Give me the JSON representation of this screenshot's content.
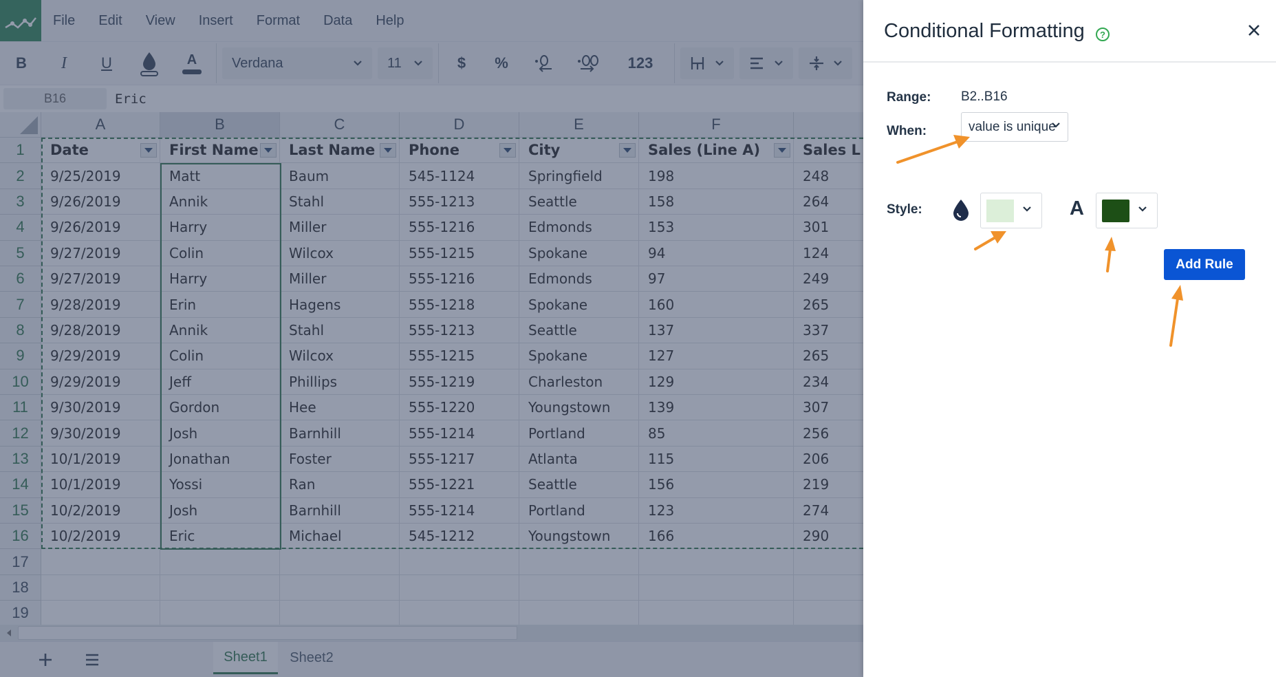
{
  "menubar": {
    "items": [
      "File",
      "Edit",
      "View",
      "Insert",
      "Format",
      "Data",
      "Help"
    ]
  },
  "toolbar": {
    "bold": "B",
    "italic": "I",
    "underline": "U",
    "font_color": "A",
    "font_family": "Verdana",
    "font_size": "11",
    "currency": "$",
    "percent": "%",
    "number_format": "123"
  },
  "formula_bar": {
    "cell_ref": "B16",
    "value": "Eric"
  },
  "grid": {
    "columns": [
      "A",
      "B",
      "C",
      "D",
      "E",
      "F"
    ],
    "selected_column": "B",
    "row_numbers": [
      "1",
      "2",
      "3",
      "4",
      "5",
      "6",
      "7",
      "8",
      "9",
      "10",
      "11",
      "12",
      "13",
      "14",
      "15",
      "16",
      "17",
      "18",
      "19"
    ],
    "header_row": [
      "Date",
      "First Name",
      "Last Name",
      "Phone",
      "City",
      "Sales (Line A)",
      "Sales L"
    ],
    "rows": [
      [
        "9/25/2019",
        "Matt",
        "Baum",
        "545-1124",
        "Springfield",
        "198",
        "248"
      ],
      [
        "9/26/2019",
        "Annik",
        "Stahl",
        "555-1213",
        "Seattle",
        "158",
        "264"
      ],
      [
        "9/26/2019",
        "Harry",
        "Miller",
        "555-1216",
        "Edmonds",
        "153",
        "301"
      ],
      [
        "9/27/2019",
        "Colin",
        "Wilcox",
        "555-1215",
        "Spokane",
        "94",
        "124"
      ],
      [
        "9/27/2019",
        "Harry",
        "Miller",
        "555-1216",
        "Edmonds",
        "97",
        "249"
      ],
      [
        "9/28/2019",
        "Erin",
        "Hagens",
        "555-1218",
        "Spokane",
        "160",
        "265"
      ],
      [
        "9/28/2019",
        "Annik",
        "Stahl",
        "555-1213",
        "Seattle",
        "137",
        "337"
      ],
      [
        "9/29/2019",
        "Colin",
        "Wilcox",
        "555-1215",
        "Spokane",
        "127",
        "265"
      ],
      [
        "9/29/2019",
        "Jeff",
        "Phillips",
        "555-1219",
        "Charleston",
        "129",
        "234"
      ],
      [
        "9/30/2019",
        "Gordon",
        "Hee",
        "555-1220",
        "Youngstown",
        "139",
        "307"
      ],
      [
        "9/30/2019",
        "Josh",
        "Barnhill",
        "555-1214",
        "Portland",
        "85",
        "256"
      ],
      [
        "10/1/2019",
        "Jonathan",
        "Foster",
        "555-1217",
        "Atlanta",
        "115",
        "206"
      ],
      [
        "10/1/2019",
        "Yossi",
        "Ran",
        "555-1221",
        "Seattle",
        "156",
        "219"
      ],
      [
        "10/2/2019",
        "Josh",
        "Barnhill",
        "555-1214",
        "Portland",
        "123",
        "274"
      ],
      [
        "10/2/2019",
        "Eric",
        "Michael",
        "545-1212",
        "Youngstown",
        "166",
        "290"
      ]
    ]
  },
  "sheets": {
    "tabs": [
      "Sheet1",
      "Sheet2"
    ],
    "active": "Sheet1"
  },
  "panel": {
    "title": "Conditional Formatting",
    "help_icon": "?",
    "range_label": "Range:",
    "range_value": "B2..B16",
    "when_label": "When:",
    "when_value": "value is unique",
    "style_label": "Style:",
    "font_color_letter": "A",
    "fill_color": "#dcefd9",
    "font_color": "#1d4f16",
    "add_rule_label": "Add Rule"
  },
  "colors": {
    "brand_green": "#1e7d45",
    "accent_blue": "#0a55d4",
    "annotation_arrow": "#f0922b"
  },
  "icons": {
    "logo": "chart-line-icon",
    "fill": "fill-drop-icon",
    "close": "close-icon",
    "help": "help-circle-icon"
  }
}
